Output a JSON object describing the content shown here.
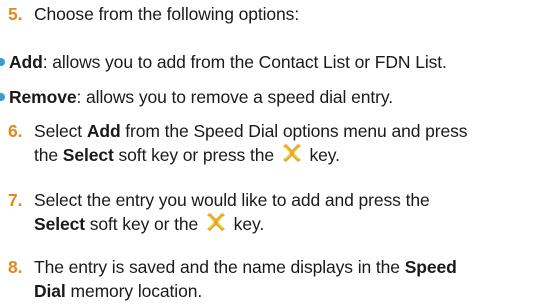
{
  "steps": {
    "s5": {
      "num": "5.",
      "text": "Choose from the following options:"
    },
    "add": {
      "bold": "Add",
      "text": ": allows you to add from the Contact List or FDN List."
    },
    "remove": {
      "bold": "Remove",
      "text": ": allows you to remove a speed dial entry."
    },
    "s6": {
      "num": "6.",
      "t1": "Select ",
      "b1": "Add",
      "t2": " from the Speed Dial options menu and press",
      "t3": "the ",
      "b2": "Select",
      "t4": " soft key or press the ",
      "t5": " key."
    },
    "s7": {
      "num": "7.",
      "t1": "Select the entry you would like to add and press the",
      "b1": "Select",
      "t2": " soft key or the ",
      "t3": " key."
    },
    "s8": {
      "num": "8.",
      "t1": "The entry is saved and the name displays in the ",
      "b1": "Speed",
      "b2": "Dial",
      "t2": " memory location."
    }
  },
  "icons": {
    "navkey": "nav-key-icon",
    "color_main": "#f0a030",
    "color_accent": "#d9e84a"
  },
  "colors": {
    "number": "#e08a1e",
    "bullet": "#3a9bd5",
    "text": "#1a1a1a"
  }
}
